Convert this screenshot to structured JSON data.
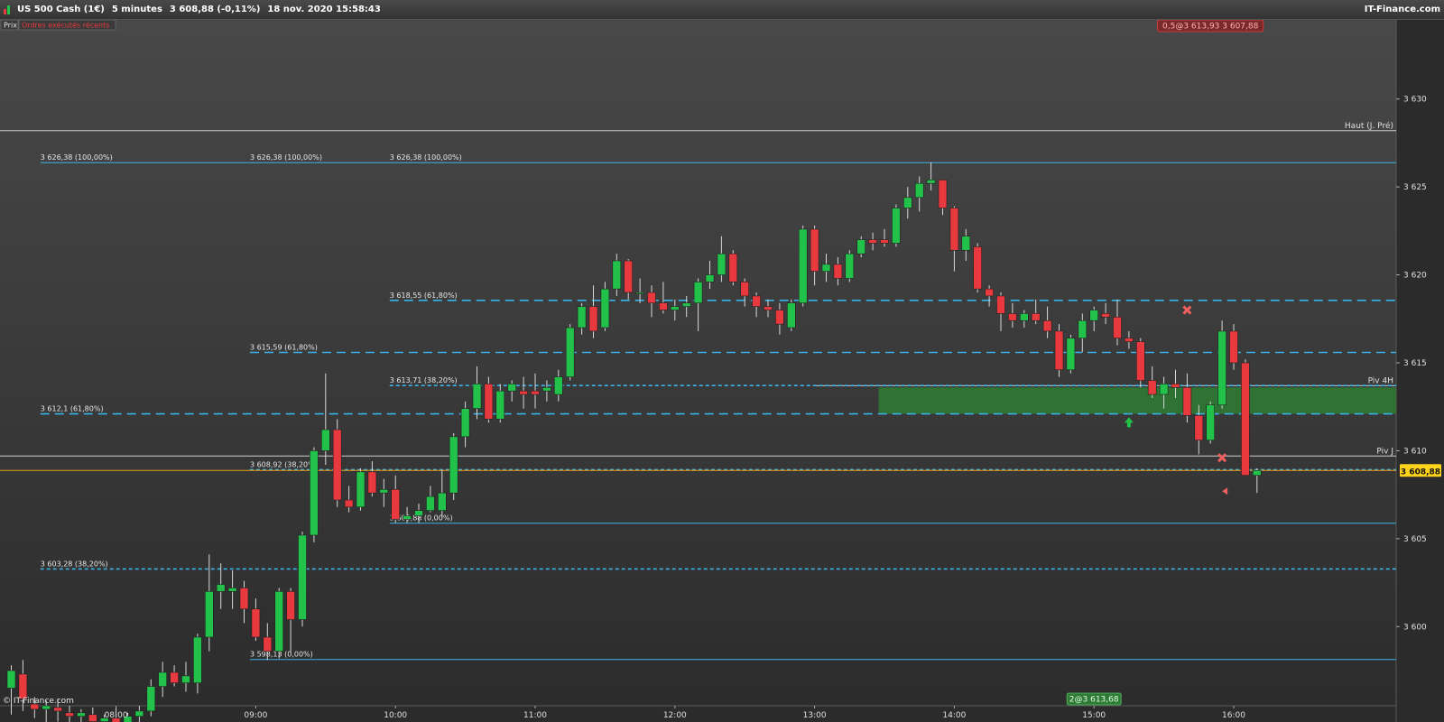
{
  "window": {
    "instrument": "US 500 Cash (1€)",
    "timeframe": "5 minutes",
    "quote": "3 608,88 (-0,11%)",
    "datetime": "18 nov. 2020 15:58:43",
    "brand": "IT-Finance.com"
  },
  "panel": {
    "tab_price": "Prix",
    "tab_orders": "Ordres exécutés récents",
    "watermark": "© IT-Finance.com"
  },
  "colors": {
    "bull": "#22c24a",
    "bear": "#e8393f",
    "fib": "#3bb2e6",
    "current": "#e5a21c",
    "zone": "#2e7d32",
    "bg_top": "#484848",
    "bg_bottom": "#2c2c2c"
  },
  "chart_data": {
    "type": "candlestick",
    "ylim": [
      3595.5,
      3634.5
    ],
    "y_ticks": [
      3600,
      3605,
      3610,
      3615,
      3620,
      3625,
      3630
    ],
    "y_tick_labels": [
      "3 600",
      "3 605",
      "3 610",
      "3 615",
      "3 620",
      "3 625",
      "3 630"
    ],
    "x_ticks": [
      {
        "label": "08:00",
        "bar": 9
      },
      {
        "label": "09:00",
        "bar": 21
      },
      {
        "label": "10:00",
        "bar": 33
      },
      {
        "label": "11:00",
        "bar": 45
      },
      {
        "label": "12:00",
        "bar": 57
      },
      {
        "label": "13:00",
        "bar": 69
      },
      {
        "label": "14:00",
        "bar": 81
      },
      {
        "label": "15:00",
        "bar": 93
      },
      {
        "label": "16:00",
        "bar": 105
      }
    ],
    "current_price": 3608.88,
    "current_price_label": "3 608,88",
    "candles": [
      {
        "o": 3596.5,
        "h": 3597.8,
        "l": 3595.0,
        "c": 3597.5
      },
      {
        "o": 3597.3,
        "h": 3598.1,
        "l": 3595.2,
        "c": 3595.9
      },
      {
        "o": 3595.6,
        "h": 3596.0,
        "l": 3594.8,
        "c": 3595.3
      },
      {
        "o": 3595.3,
        "h": 3595.8,
        "l": 3594.5,
        "c": 3595.5
      },
      {
        "o": 3595.4,
        "h": 3595.9,
        "l": 3594.6,
        "c": 3595.2
      },
      {
        "o": 3595.1,
        "h": 3595.5,
        "l": 3594.4,
        "c": 3594.9
      },
      {
        "o": 3594.9,
        "h": 3595.3,
        "l": 3594.3,
        "c": 3595.1
      },
      {
        "o": 3595.0,
        "h": 3595.4,
        "l": 3594.2,
        "c": 3594.6
      },
      {
        "o": 3594.6,
        "h": 3595.0,
        "l": 3594.0,
        "c": 3594.8
      },
      {
        "o": 3594.8,
        "h": 3595.4,
        "l": 3594.2,
        "c": 3594.5
      },
      {
        "o": 3594.5,
        "h": 3595.1,
        "l": 3594.0,
        "c": 3594.9
      },
      {
        "o": 3594.9,
        "h": 3595.5,
        "l": 3594.5,
        "c": 3595.2
      },
      {
        "o": 3595.2,
        "h": 3597.0,
        "l": 3594.9,
        "c": 3596.6
      },
      {
        "o": 3596.6,
        "h": 3598.0,
        "l": 3596.0,
        "c": 3597.4
      },
      {
        "o": 3597.4,
        "h": 3597.8,
        "l": 3596.6,
        "c": 3596.8
      },
      {
        "o": 3596.8,
        "h": 3598.0,
        "l": 3596.3,
        "c": 3597.2
      },
      {
        "o": 3596.8,
        "h": 3599.6,
        "l": 3596.2,
        "c": 3599.4
      },
      {
        "o": 3599.4,
        "h": 3604.1,
        "l": 3598.6,
        "c": 3602.0
      },
      {
        "o": 3602.0,
        "h": 3603.6,
        "l": 3601.0,
        "c": 3602.4
      },
      {
        "o": 3602.0,
        "h": 3603.2,
        "l": 3601.0,
        "c": 3602.2
      },
      {
        "o": 3602.2,
        "h": 3602.6,
        "l": 3600.2,
        "c": 3601.0
      },
      {
        "o": 3601.0,
        "h": 3601.6,
        "l": 3599.2,
        "c": 3599.4
      },
      {
        "o": 3599.4,
        "h": 3600.2,
        "l": 3598.1,
        "c": 3598.6
      },
      {
        "o": 3598.6,
        "h": 3602.2,
        "l": 3598.2,
        "c": 3602.0
      },
      {
        "o": 3602.0,
        "h": 3602.2,
        "l": 3598.5,
        "c": 3600.4
      },
      {
        "o": 3600.4,
        "h": 3605.4,
        "l": 3600.0,
        "c": 3605.2
      },
      {
        "o": 3605.2,
        "h": 3610.2,
        "l": 3604.8,
        "c": 3610.0
      },
      {
        "o": 3610.0,
        "h": 3614.4,
        "l": 3609.2,
        "c": 3611.2
      },
      {
        "o": 3611.2,
        "h": 3611.8,
        "l": 3606.8,
        "c": 3607.2
      },
      {
        "o": 3607.2,
        "h": 3608.0,
        "l": 3606.5,
        "c": 3606.8
      },
      {
        "o": 3606.8,
        "h": 3609.0,
        "l": 3606.6,
        "c": 3608.8
      },
      {
        "o": 3608.8,
        "h": 3609.4,
        "l": 3607.4,
        "c": 3607.6
      },
      {
        "o": 3607.6,
        "h": 3608.4,
        "l": 3606.8,
        "c": 3607.8
      },
      {
        "o": 3607.8,
        "h": 3608.6,
        "l": 3605.9,
        "c": 3606.1
      },
      {
        "o": 3606.1,
        "h": 3606.8,
        "l": 3605.9,
        "c": 3606.3
      },
      {
        "o": 3606.3,
        "h": 3607.0,
        "l": 3605.9,
        "c": 3606.6
      },
      {
        "o": 3606.6,
        "h": 3608.0,
        "l": 3606.5,
        "c": 3607.4
      },
      {
        "o": 3606.6,
        "h": 3608.9,
        "l": 3606.2,
        "c": 3607.6
      },
      {
        "o": 3607.6,
        "h": 3611.0,
        "l": 3607.2,
        "c": 3610.8
      },
      {
        "o": 3610.8,
        "h": 3612.8,
        "l": 3610.2,
        "c": 3612.4
      },
      {
        "o": 3612.4,
        "h": 3614.8,
        "l": 3611.8,
        "c": 3613.8
      },
      {
        "o": 3613.8,
        "h": 3614.2,
        "l": 3611.6,
        "c": 3611.8
      },
      {
        "o": 3611.8,
        "h": 3613.8,
        "l": 3611.6,
        "c": 3613.4
      },
      {
        "o": 3613.4,
        "h": 3614.0,
        "l": 3612.8,
        "c": 3613.8
      },
      {
        "o": 3613.4,
        "h": 3614.2,
        "l": 3612.4,
        "c": 3613.2
      },
      {
        "o": 3613.4,
        "h": 3614.4,
        "l": 3612.4,
        "c": 3613.2
      },
      {
        "o": 3613.4,
        "h": 3614.0,
        "l": 3612.8,
        "c": 3613.6
      },
      {
        "o": 3613.2,
        "h": 3614.6,
        "l": 3612.8,
        "c": 3614.2
      },
      {
        "o": 3614.2,
        "h": 3617.2,
        "l": 3614.0,
        "c": 3617.0
      },
      {
        "o": 3617.0,
        "h": 3618.4,
        "l": 3616.6,
        "c": 3618.2
      },
      {
        "o": 3618.2,
        "h": 3619.4,
        "l": 3616.4,
        "c": 3616.8
      },
      {
        "o": 3617.0,
        "h": 3619.6,
        "l": 3616.8,
        "c": 3619.2
      },
      {
        "o": 3619.2,
        "h": 3621.2,
        "l": 3618.8,
        "c": 3620.8
      },
      {
        "o": 3620.8,
        "h": 3620.9,
        "l": 3618.6,
        "c": 3619.0
      },
      {
        "o": 3619.0,
        "h": 3619.8,
        "l": 3618.4,
        "c": 3619.0
      },
      {
        "o": 3619.0,
        "h": 3619.4,
        "l": 3617.6,
        "c": 3618.4
      },
      {
        "o": 3618.4,
        "h": 3619.6,
        "l": 3617.8,
        "c": 3618.0
      },
      {
        "o": 3618.0,
        "h": 3618.6,
        "l": 3617.4,
        "c": 3618.2
      },
      {
        "o": 3618.2,
        "h": 3618.8,
        "l": 3617.6,
        "c": 3618.4
      },
      {
        "o": 3618.4,
        "h": 3619.8,
        "l": 3616.8,
        "c": 3619.6
      },
      {
        "o": 3619.6,
        "h": 3620.8,
        "l": 3619.2,
        "c": 3620.0
      },
      {
        "o": 3620.0,
        "h": 3622.2,
        "l": 3619.6,
        "c": 3621.2
      },
      {
        "o": 3621.2,
        "h": 3621.4,
        "l": 3619.4,
        "c": 3619.6
      },
      {
        "o": 3619.6,
        "h": 3619.8,
        "l": 3618.2,
        "c": 3618.8
      },
      {
        "o": 3618.8,
        "h": 3619.0,
        "l": 3617.6,
        "c": 3618.2
      },
      {
        "o": 3618.2,
        "h": 3618.6,
        "l": 3617.6,
        "c": 3618.0
      },
      {
        "o": 3618.0,
        "h": 3618.4,
        "l": 3616.6,
        "c": 3617.2
      },
      {
        "o": 3617.0,
        "h": 3618.6,
        "l": 3616.8,
        "c": 3618.4
      },
      {
        "o": 3618.4,
        "h": 3622.8,
        "l": 3618.2,
        "c": 3622.6
      },
      {
        "o": 3622.6,
        "h": 3622.8,
        "l": 3619.4,
        "c": 3620.2
      },
      {
        "o": 3620.2,
        "h": 3621.2,
        "l": 3619.6,
        "c": 3620.6
      },
      {
        "o": 3620.6,
        "h": 3621.0,
        "l": 3619.4,
        "c": 3619.8
      },
      {
        "o": 3619.8,
        "h": 3621.4,
        "l": 3619.6,
        "c": 3621.2
      },
      {
        "o": 3621.2,
        "h": 3622.2,
        "l": 3621.0,
        "c": 3622.0
      },
      {
        "o": 3622.0,
        "h": 3622.4,
        "l": 3621.4,
        "c": 3621.8
      },
      {
        "o": 3622.0,
        "h": 3622.6,
        "l": 3621.6,
        "c": 3621.8
      },
      {
        "o": 3621.8,
        "h": 3624.0,
        "l": 3621.6,
        "c": 3623.8
      },
      {
        "o": 3623.8,
        "h": 3625.0,
        "l": 3623.2,
        "c": 3624.4
      },
      {
        "o": 3624.4,
        "h": 3625.6,
        "l": 3623.6,
        "c": 3625.2
      },
      {
        "o": 3625.2,
        "h": 3626.4,
        "l": 3624.8,
        "c": 3625.4
      },
      {
        "o": 3625.4,
        "h": 3625.4,
        "l": 3623.4,
        "c": 3623.8
      },
      {
        "o": 3623.8,
        "h": 3623.9,
        "l": 3620.2,
        "c": 3621.4
      },
      {
        "o": 3621.4,
        "h": 3622.6,
        "l": 3620.8,
        "c": 3622.2
      },
      {
        "o": 3621.6,
        "h": 3621.8,
        "l": 3619.0,
        "c": 3619.2
      },
      {
        "o": 3619.2,
        "h": 3619.4,
        "l": 3618.2,
        "c": 3618.8
      },
      {
        "o": 3618.8,
        "h": 3619.0,
        "l": 3616.8,
        "c": 3617.8
      },
      {
        "o": 3617.8,
        "h": 3618.4,
        "l": 3617.0,
        "c": 3617.4
      },
      {
        "o": 3617.4,
        "h": 3618.0,
        "l": 3617.0,
        "c": 3617.8
      },
      {
        "o": 3617.8,
        "h": 3618.6,
        "l": 3617.2,
        "c": 3617.4
      },
      {
        "o": 3617.4,
        "h": 3618.2,
        "l": 3616.4,
        "c": 3616.8
      },
      {
        "o": 3616.8,
        "h": 3617.2,
        "l": 3614.2,
        "c": 3614.6
      },
      {
        "o": 3614.6,
        "h": 3616.6,
        "l": 3614.4,
        "c": 3616.4
      },
      {
        "o": 3616.4,
        "h": 3617.8,
        "l": 3615.6,
        "c": 3617.4
      },
      {
        "o": 3617.4,
        "h": 3618.2,
        "l": 3616.8,
        "c": 3618.0
      },
      {
        "o": 3617.8,
        "h": 3618.4,
        "l": 3617.2,
        "c": 3617.6
      },
      {
        "o": 3617.6,
        "h": 3618.6,
        "l": 3616.0,
        "c": 3616.4
      },
      {
        "o": 3616.4,
        "h": 3616.8,
        "l": 3615.8,
        "c": 3616.2
      },
      {
        "o": 3616.2,
        "h": 3616.4,
        "l": 3613.6,
        "c": 3614.0
      },
      {
        "o": 3614.0,
        "h": 3614.8,
        "l": 3613.0,
        "c": 3613.2
      },
      {
        "o": 3613.2,
        "h": 3614.2,
        "l": 3612.4,
        "c": 3613.8
      },
      {
        "o": 3613.8,
        "h": 3614.6,
        "l": 3613.0,
        "c": 3613.6
      },
      {
        "o": 3613.6,
        "h": 3614.4,
        "l": 3611.6,
        "c": 3612.0
      },
      {
        "o": 3612.0,
        "h": 3612.6,
        "l": 3609.8,
        "c": 3610.6
      },
      {
        "o": 3610.6,
        "h": 3612.8,
        "l": 3610.4,
        "c": 3612.6
      },
      {
        "o": 3612.6,
        "h": 3617.4,
        "l": 3612.4,
        "c": 3616.8
      },
      {
        "o": 3616.8,
        "h": 3617.2,
        "l": 3614.6,
        "c": 3615.0
      },
      {
        "o": 3615.0,
        "h": 3615.2,
        "l": 3608.6,
        "c": 3608.6
      },
      {
        "o": 3608.6,
        "h": 3609.0,
        "l": 3607.6,
        "c": 3608.88
      }
    ],
    "levels": [
      {
        "price": 3626.38,
        "label": "3 626,38 (100,00%)",
        "style": "solid",
        "from_bar": 3,
        "label_bars": [
          3,
          21,
          33
        ]
      },
      {
        "price": 3618.55,
        "label": "3 618,55 (61,80%)",
        "style": "dashed",
        "from_bar": 33,
        "label_bars": [
          33
        ]
      },
      {
        "price": 3615.59,
        "label": "3 615,59 (61,80%)",
        "style": "dashed",
        "from_bar": 21,
        "label_bars": [
          21
        ]
      },
      {
        "price": 3613.71,
        "label": "3 613,71 (38,20%)",
        "style": "dotted",
        "from_bar": 33,
        "label_bars": [
          33
        ]
      },
      {
        "price": 3612.1,
        "label": "3 612,1 (61,80%)",
        "style": "dashed",
        "from_bar": 3,
        "label_bars": [
          3
        ]
      },
      {
        "price": 3608.92,
        "label": "3 608,92 (38,20%)",
        "style": "dotted",
        "from_bar": 21,
        "label_bars": [
          21
        ]
      },
      {
        "price": 3605.88,
        "label": "3 605,88 (0,00%)",
        "style": "solid",
        "from_bar": 33,
        "label_bars": [
          33
        ]
      },
      {
        "price": 3603.28,
        "label": "3 603,28 (38,20%)",
        "style": "dotted",
        "from_bar": 3,
        "label_bars": [
          3
        ]
      },
      {
        "price": 3598.13,
        "label": "3 598,13 (0,00%)",
        "style": "solid",
        "from_bar": 21,
        "label_bars": [
          21
        ]
      }
    ],
    "reference_lines": [
      {
        "price": 3628.2,
        "label": "Haut (J. Pré)",
        "from_bar": 0
      },
      {
        "price": 3613.7,
        "label": "Piv 4H",
        "from_bar": 69
      },
      {
        "price": 3609.7,
        "label": "Piv J",
        "from_bar": 0
      }
    ],
    "zone": {
      "from_bar": 75,
      "y_high": 3613.6,
      "y_low": 3612.1
    },
    "orders": [
      {
        "label": "0,5@3 613,93 3 607,88",
        "bar": 103,
        "price": 3634.5,
        "color": "red"
      },
      {
        "label": "2@3 613,68",
        "bar": 93,
        "price": 3595.6,
        "color": "green"
      }
    ],
    "markers": [
      {
        "type": "cross",
        "bar": 101,
        "price": 3618.0
      },
      {
        "type": "cross",
        "bar": 104,
        "price": 3609.6
      },
      {
        "type": "arrow-up",
        "bar": 96,
        "price": 3611.9
      },
      {
        "type": "triangle-left",
        "bar": 104,
        "price": 3607.7
      }
    ]
  }
}
